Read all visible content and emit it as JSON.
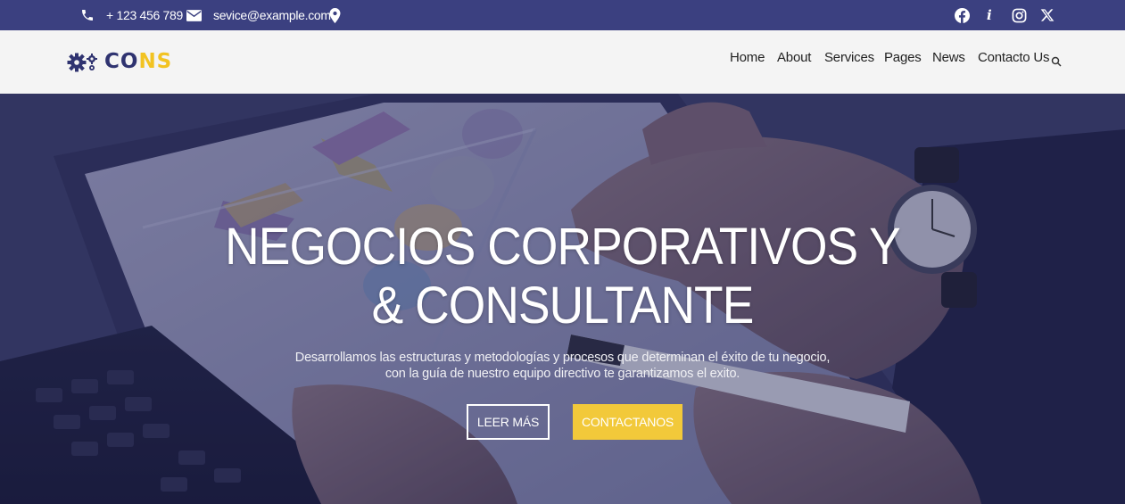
{
  "topbar": {
    "phone": "+ 123 456 789",
    "email": "sevice@example.com",
    "icons": [
      "phone-icon",
      "mail-icon",
      "location-icon",
      "facebook-icon",
      "info-icon",
      "instagram-icon",
      "x-icon"
    ]
  },
  "brand": {
    "name_part1": "CO",
    "name_part2": "NS",
    "icon": "gears-icon"
  },
  "nav": {
    "items": [
      "Home",
      "About",
      "Services",
      "Pages",
      "News",
      "Contacto Us"
    ],
    "search_icon": "search-icon"
  },
  "hero": {
    "title_line1": "NEGOCIOS CORPORATIVOS Y",
    "title_line2": "& CONSULTANTE",
    "subtitle_line1": "Desarrollamos las estructuras y metodologías y procesos que determinan el éxito de tu negocio,",
    "subtitle_line2": "con la guía de nuestro equipo directivo te garantizamos el exito.",
    "btn_more": "LEER MÁS",
    "btn_contact": "CONTACTANOS"
  },
  "colors": {
    "topbar": "#3b4080",
    "brand_dark": "#2f3370",
    "accent": "#f2c322"
  }
}
